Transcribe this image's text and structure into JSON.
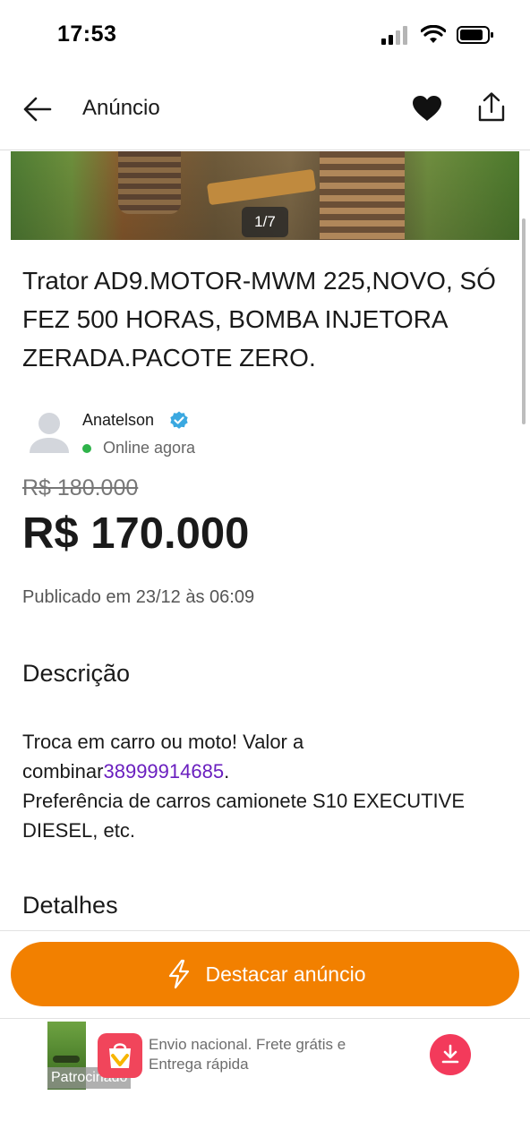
{
  "status_bar": {
    "time": "17:53"
  },
  "header": {
    "title": "Anúncio",
    "back_icon": "arrow-left-icon",
    "favorite_icon": "heart-icon",
    "share_icon": "share-icon"
  },
  "gallery": {
    "counter": "1/7"
  },
  "ad": {
    "title": "Trator AD9.MOTOR-MWM 225,NOVO, SÓ FEZ 500 HORAS, BOMBA INJETORA ZERADA.PACOTE ZERO.",
    "seller": {
      "name": "Anatelson",
      "status": "Online agora"
    },
    "old_price": "R$ 180.000",
    "price": "R$ 170.000",
    "published": "Publicado em 23/12 às 06:09"
  },
  "description": {
    "title": "Descrição",
    "line1": "Troca em carro ou moto! Valor a combinar",
    "phone": "38999914685",
    "line1_end": ".",
    "line2": "Preferência de carros camionete S10 EXECUTIVE DIESEL, etc."
  },
  "details": {
    "title": "Detalhes"
  },
  "footer": {
    "promote_label": "Destacar anúncio"
  },
  "sponsored_ad": {
    "badge": "Patrocinado",
    "text": "Envio nacional. Frete grátis e Entrega rápida"
  },
  "colors": {
    "accent": "#f28000",
    "link": "#6a1fbf",
    "online": "#2eb34a",
    "verified": "#3aa8e0"
  }
}
